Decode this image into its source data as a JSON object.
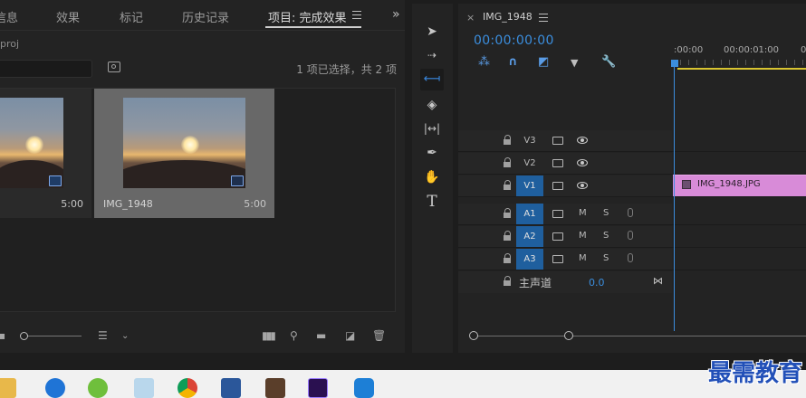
{
  "project_panel": {
    "tabs": [
      {
        "label": "信息"
      },
      {
        "label": "效果"
      },
      {
        "label": "标记"
      },
      {
        "label": "历史记录"
      },
      {
        "label": "项目: 完成效果"
      }
    ],
    "filename": "proj",
    "search": {
      "value": "",
      "placeholder": ""
    },
    "selection_status": "1 项已选择，共 2 项",
    "clips": [
      {
        "name": "",
        "duration": "5:00"
      },
      {
        "name": "IMG_1948",
        "duration": "5:00"
      }
    ],
    "icons": [
      "menu-icon",
      "overflow-icon",
      "bin-search-icon",
      "list-view-icon",
      "sort-icon",
      "automate-icon",
      "find-icon",
      "new-bin-icon",
      "new-item-icon",
      "trash-icon"
    ]
  },
  "tools": [
    {
      "name": "selection-tool"
    },
    {
      "name": "track-select-tool"
    },
    {
      "name": "ripple-edit-tool",
      "active": true
    },
    {
      "name": "razor-tool"
    },
    {
      "name": "slip-tool"
    },
    {
      "name": "pen-tool"
    },
    {
      "name": "hand-tool"
    },
    {
      "name": "type-tool",
      "glyph": "T"
    }
  ],
  "timeline": {
    "sequence_name": "IMG_1948",
    "close_glyph": "×",
    "timecode": "00:00:00:00",
    "ruler_labels": [
      ":00:00",
      "00:00:01:00",
      "0"
    ],
    "video_tracks": [
      {
        "label": "V3",
        "selected": false
      },
      {
        "label": "V2",
        "selected": false
      },
      {
        "label": "V1",
        "selected": true
      }
    ],
    "audio_tracks": [
      {
        "label": "A1",
        "selected": true,
        "mute": "M",
        "solo": "S"
      },
      {
        "label": "A2",
        "selected": true,
        "mute": "M",
        "solo": "S"
      },
      {
        "label": "A3",
        "selected": true,
        "mute": "M",
        "solo": "S"
      }
    ],
    "master": {
      "label": "主声道",
      "value": "0.0"
    },
    "clip": {
      "name": "IMG_1948.JPG",
      "color": "#d88bd8"
    }
  },
  "taskbar": {
    "apps": [
      "file-explorer-icon",
      "edge-icon",
      "app-green-icon",
      "app-eraser-icon",
      "chrome-icon",
      "word-icon",
      "app-game-icon",
      "premiere-icon",
      "app-phone-icon"
    ]
  },
  "watermark": "最需教育",
  "colors": {
    "accent": "#3b8ede",
    "clip": "#d88bd8",
    "work_bar": "#d8c431"
  }
}
